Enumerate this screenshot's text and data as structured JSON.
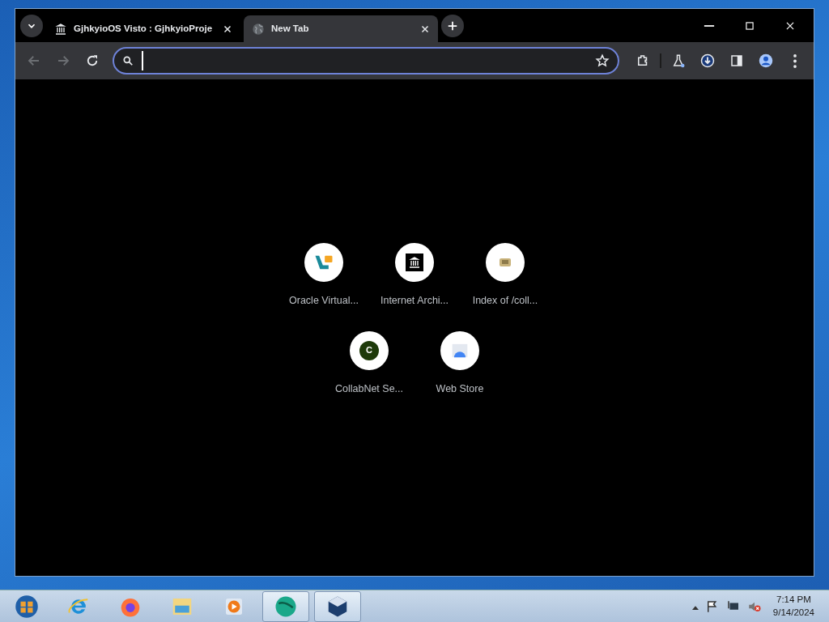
{
  "tabs": [
    {
      "title": "GjhkyioOS Visto : GjhkyioProje",
      "selected": false
    },
    {
      "title": "New Tab",
      "selected": true
    }
  ],
  "omnibox": {
    "focused": true
  },
  "shortcuts": [
    {
      "label": "Oracle Virtual..."
    },
    {
      "label": "Internet Archi..."
    },
    {
      "label": "Index of /coll..."
    },
    {
      "label": "CollabNet Se...",
      "letter": "C"
    },
    {
      "label": "Web Store"
    }
  ],
  "taskbar": {
    "apps": [
      {
        "kind": "start",
        "selected": false
      },
      {
        "kind": "ie",
        "selected": false
      },
      {
        "kind": "firefox",
        "selected": false
      },
      {
        "kind": "folder",
        "selected": false
      },
      {
        "kind": "media",
        "selected": false
      },
      {
        "kind": "browser",
        "selected": true
      },
      {
        "kind": "cube",
        "selected": true
      }
    ],
    "time": "7:14 PM",
    "date": "9/14/2024"
  }
}
